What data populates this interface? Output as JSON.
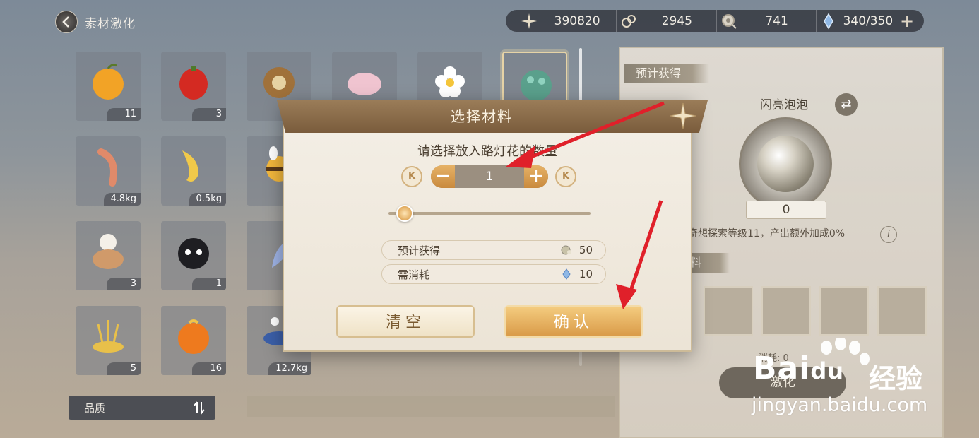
{
  "header": {
    "title": "素材激化"
  },
  "currencies": [
    {
      "icon": "star-icon",
      "value": "390820"
    },
    {
      "icon": "shell-icon",
      "value": "2945"
    },
    {
      "icon": "coin-icon",
      "value": "741"
    },
    {
      "icon": "crystal-icon",
      "value": "340/350"
    }
  ],
  "grid": {
    "items": [
      {
        "name": "orange-fruit",
        "count": "11"
      },
      {
        "name": "red-pepper",
        "count": "3"
      },
      {
        "name": "pinecone",
        "count": ""
      },
      {
        "name": "pink-flower",
        "count": ""
      },
      {
        "name": "white-flower",
        "count": ""
      },
      {
        "name": "green-berry",
        "count": ""
      },
      {
        "name": "shrimp",
        "count": "4.8kg"
      },
      {
        "name": "goldfish",
        "count": "0.5kg"
      },
      {
        "name": "bee",
        "count": ""
      },
      {
        "name": "mushroom",
        "count": "3"
      },
      {
        "name": "black-cat",
        "count": "1"
      },
      {
        "name": "feather",
        "count": ""
      },
      {
        "name": "golden-grass",
        "count": "5"
      },
      {
        "name": "orange",
        "count": "16"
      },
      {
        "name": "fish",
        "count": "12.7kg"
      }
    ]
  },
  "filter": {
    "label": "品质"
  },
  "panel": {
    "section_label": "预计获得",
    "product_name": "闪亮泡泡",
    "product_count": "0",
    "bonus_text": "奇想探索等级11，产出额外加成0%",
    "materials_label": "料",
    "consume_label": "消耗: 0",
    "action_label": "激化"
  },
  "dialog": {
    "title": "选择材料",
    "prompt": "请选择放入路灯花的数量",
    "quantity": "1",
    "min_label": "K",
    "max_label": "K",
    "slider_value": 0.02,
    "estimate_label": "预计获得",
    "estimate_value": "50",
    "cost_label": "需消耗",
    "cost_value": "10",
    "clear_label": "清空",
    "confirm_label": "确认"
  },
  "watermark": {
    "brand": "Bai",
    "brand2": "du",
    "cn": "经验",
    "url": "jingyan.baidu.com"
  },
  "colors": {
    "accent": "#d99a48",
    "arrow": "#e0202a",
    "header": "#7a5c3c"
  }
}
